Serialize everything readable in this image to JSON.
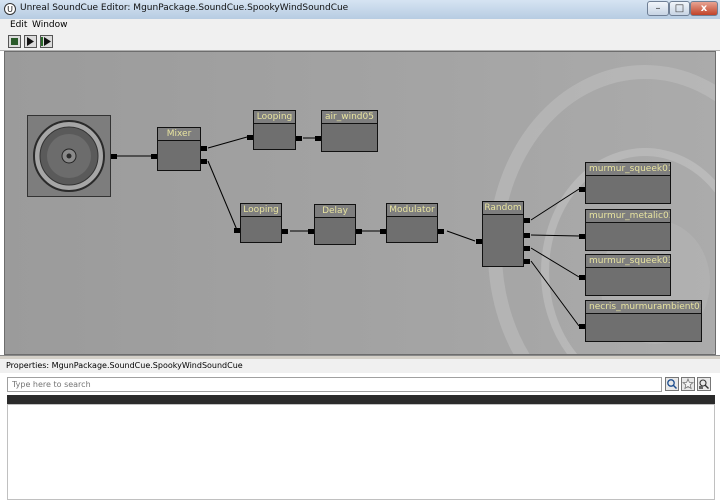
{
  "window": {
    "title": "Unreal SoundCue Editor: MgunPackage.SoundCue.SpookyWindSoundCue",
    "minimize_glyph": "–",
    "maximize_glyph": "□",
    "close_glyph": "x"
  },
  "menu": {
    "items": [
      "Edit",
      "Window"
    ]
  },
  "toolbar": {
    "buttons": [
      "stop-icon",
      "play-icon",
      "play-node-icon"
    ]
  },
  "nodes": {
    "mixer": "Mixer",
    "looping1": "Looping",
    "air_wind": "air_wind05",
    "looping2": "Looping",
    "delay": "Delay",
    "modulator": "Modulator",
    "random": "Random",
    "wave1": "murmur_squeek01",
    "wave2": "murmur_metalic03",
    "wave3": "murmur_squeek03",
    "wave4": "necris_murmurambient01"
  },
  "properties": {
    "header": "Properties: MgunPackage.SoundCue.SpookyWindSoundCue",
    "search_placeholder": "Type here to search",
    "search_icons": [
      "magnifier-icon",
      "star-icon",
      "settings-search-icon"
    ]
  },
  "colors": {
    "canvas": "#a4a4a4",
    "node_body": "#6f6f6f",
    "node_title": "#e8e4a0",
    "wire": "#000000"
  }
}
